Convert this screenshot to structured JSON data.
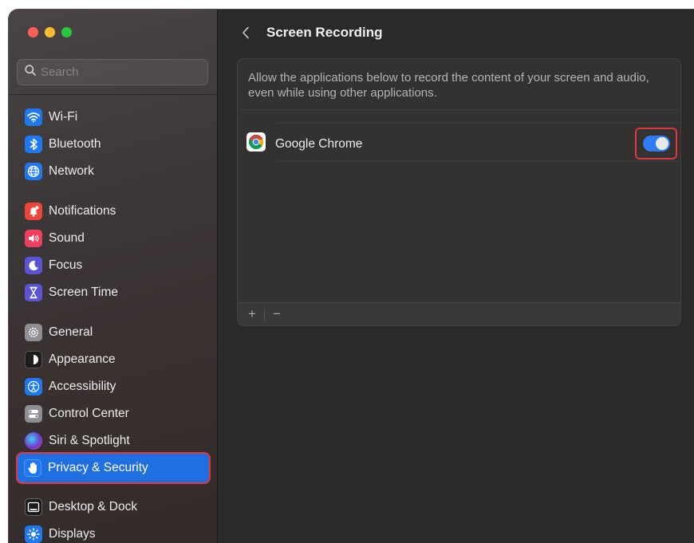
{
  "window": {
    "traffic_lights": {
      "close": "#fe5f57",
      "minimize": "#febc2e",
      "maximize": "#28c840"
    }
  },
  "sidebar": {
    "search_placeholder": "Search",
    "items": [
      {
        "label": "Wi-Fi",
        "icon": "wifi-icon",
        "color": "#1e78f0"
      },
      {
        "label": "Bluetooth",
        "icon": "bluetooth-icon",
        "color": "#1e78f0"
      },
      {
        "label": "Network",
        "icon": "globe-icon",
        "color": "#1e78f0"
      },
      {
        "label": "Notifications",
        "icon": "bell-icon",
        "color": "#f0453a"
      },
      {
        "label": "Sound",
        "icon": "speaker-icon",
        "color": "#f23d5f"
      },
      {
        "label": "Focus",
        "icon": "moon-icon",
        "color": "#5b55d6"
      },
      {
        "label": "Screen Time",
        "icon": "hourglass-icon",
        "color": "#5b55d6"
      },
      {
        "label": "General",
        "icon": "gear-icon",
        "color": "#8e8e93"
      },
      {
        "label": "Appearance",
        "icon": "appearance-icon",
        "color": "#1c1c1e"
      },
      {
        "label": "Accessibility",
        "icon": "accessibility-icon",
        "color": "#1e78f0"
      },
      {
        "label": "Control Center",
        "icon": "switches-icon",
        "color": "#8e8e93"
      },
      {
        "label": "Siri & Spotlight",
        "icon": "siri-icon",
        "color": "#6b3fd1"
      },
      {
        "label": "Privacy & Security",
        "icon": "hand-icon",
        "color": "#1e78f0",
        "active": true
      },
      {
        "label": "Desktop & Dock",
        "icon": "dock-icon",
        "color": "#1c1c1e"
      },
      {
        "label": "Displays",
        "icon": "sun-icon",
        "color": "#1e78f0"
      }
    ]
  },
  "main": {
    "title": "Screen Recording",
    "description": "Allow the applications below to record the content of your screen and audio, even while using other applications.",
    "apps": [
      {
        "name": "Google Chrome",
        "icon": "chrome-icon",
        "enabled": true
      }
    ],
    "footer": {
      "add": "+",
      "remove": "−"
    }
  },
  "colors": {
    "accent": "#1f6fe0",
    "highlight": "#e0383e",
    "toggle_on": "#2f7cf6"
  }
}
